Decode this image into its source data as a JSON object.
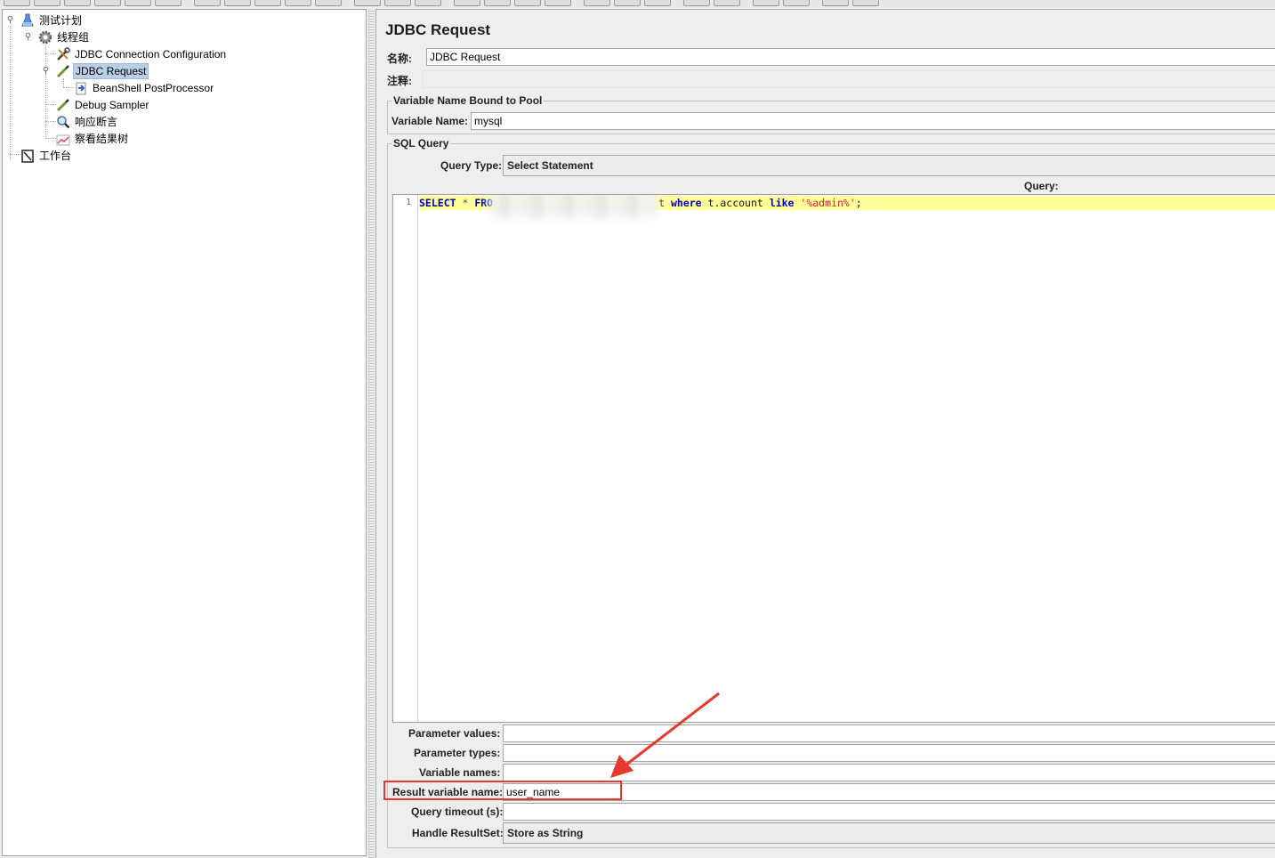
{
  "tree": {
    "items": [
      {
        "label": "测试计划",
        "icon": "flask-icon"
      },
      {
        "label": "线程组",
        "icon": "gear-icon"
      },
      {
        "label": "JDBC Connection Configuration",
        "icon": "wrench-icon"
      },
      {
        "label": "JDBC Request",
        "icon": "pipette-icon",
        "selected": true
      },
      {
        "label": "BeanShell PostProcessor",
        "icon": "arrow-doc-icon"
      },
      {
        "label": "Debug Sampler",
        "icon": "pipette-icon"
      },
      {
        "label": "响应断言",
        "icon": "magnifier-icon"
      },
      {
        "label": "察看结果树",
        "icon": "chart-icon"
      },
      {
        "label": "工作台",
        "icon": "workbench-icon"
      }
    ]
  },
  "panel": {
    "title": "JDBC Request",
    "name_label": "名称:",
    "name_value": "JDBC Request",
    "comment_label": "注释:",
    "comment_value": ""
  },
  "pool": {
    "section_title": "Variable Name Bound to Pool",
    "variable_label": "Variable Name:",
    "variable_value": "mysql"
  },
  "sql": {
    "section_title": "SQL Query",
    "query_type_label": "Query Type:",
    "query_type_value": "Select Statement",
    "query_header": "Query:",
    "line_number": "1",
    "code": {
      "select": "SELECT",
      "star": " * ",
      "from": "FRO",
      "tail_t": "t ",
      "where": "where",
      "column": " t.account ",
      "like": "like",
      "space": " ",
      "pattern": "'%admin%'",
      "semi": ";"
    }
  },
  "params": {
    "parameter_values_label": "Parameter values:",
    "parameter_values_value": "",
    "parameter_types_label": "Parameter types:",
    "parameter_types_value": "",
    "variable_names_label": "Variable names:",
    "variable_names_value": "",
    "result_variable_label": "Result variable name:",
    "result_variable_value": "user_name",
    "query_timeout_label": "Query timeout (s):",
    "query_timeout_value": "",
    "handle_resultset_label": "Handle ResultSet:",
    "handle_resultset_value": "Store as String"
  },
  "colors": {
    "selection": "#b8cfe5",
    "annotation_red": "#e8392f",
    "editor_current_line": "#ffff99"
  }
}
